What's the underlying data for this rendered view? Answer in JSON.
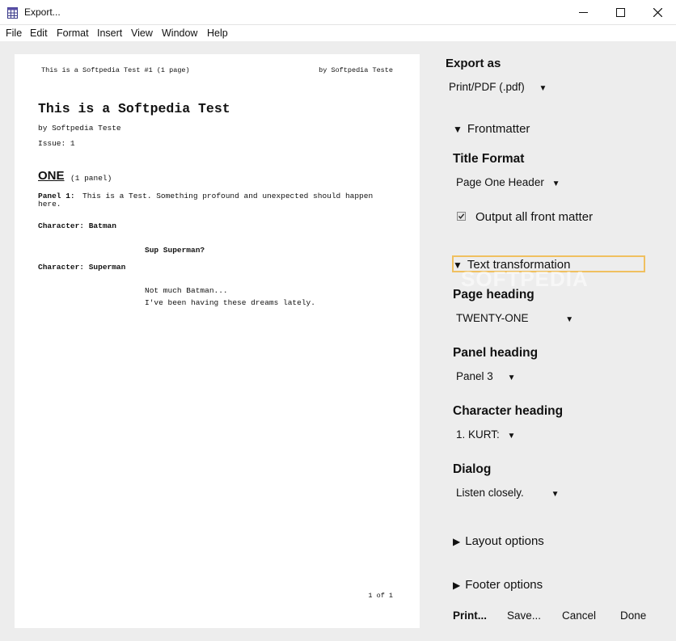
{
  "window": {
    "title": "Export...",
    "icon": "calendar-grid-icon",
    "controls": [
      "minimize-icon",
      "maximize-icon",
      "close-icon"
    ]
  },
  "menu": [
    "File",
    "Edit",
    "Format",
    "Insert",
    "View",
    "Window",
    "Help"
  ],
  "preview": {
    "header_left": "This is a Softpedia Test #1 (1 page)",
    "header_right": "by Softpedia Teste",
    "doc_title": "This is a Softpedia Test",
    "byline": "by Softpedia Teste",
    "issue": "Issue: 1",
    "page_heading": "ONE",
    "page_panels": "(1 panel)",
    "panel_label": "Panel 1:",
    "panel_text_1": "This is a Test. Something profound and unexpected should happen",
    "panel_text_2": "here.",
    "char1": "Character: Batman",
    "dialog1": "Sup Superman?",
    "char2": "Character: Superman",
    "dialog2_1": "Not much Batman...",
    "dialog2_2": "I've been having these dreams lately.",
    "footer": "1 of 1"
  },
  "sidebar": {
    "export_as_label": "Export as",
    "export_as_value": "Print/PDF (.pdf)",
    "frontmatter_label": "Frontmatter",
    "title_format_label": "Title Format",
    "title_format_value": "Page One Header",
    "output_front_matter_label": "Output all front matter",
    "output_front_matter_checked": true,
    "text_transformation_label": "Text transformation",
    "page_heading_label": "Page heading",
    "page_heading_value": "TWENTY-ONE",
    "panel_heading_label": "Panel heading",
    "panel_heading_value": "Panel 3",
    "character_heading_label": "Character heading",
    "character_heading_value": "1. KURT:",
    "dialog_label": "Dialog",
    "dialog_value": "Listen closely.",
    "layout_options_label": "Layout options",
    "footer_options_label": "Footer options"
  },
  "buttons": {
    "print": "Print...",
    "save": "Save...",
    "cancel": "Cancel",
    "done": "Done"
  },
  "watermark": "SOFTPEDIA",
  "colors": {
    "focus_outline": "#f0c060",
    "window_bg": "#ededed"
  }
}
